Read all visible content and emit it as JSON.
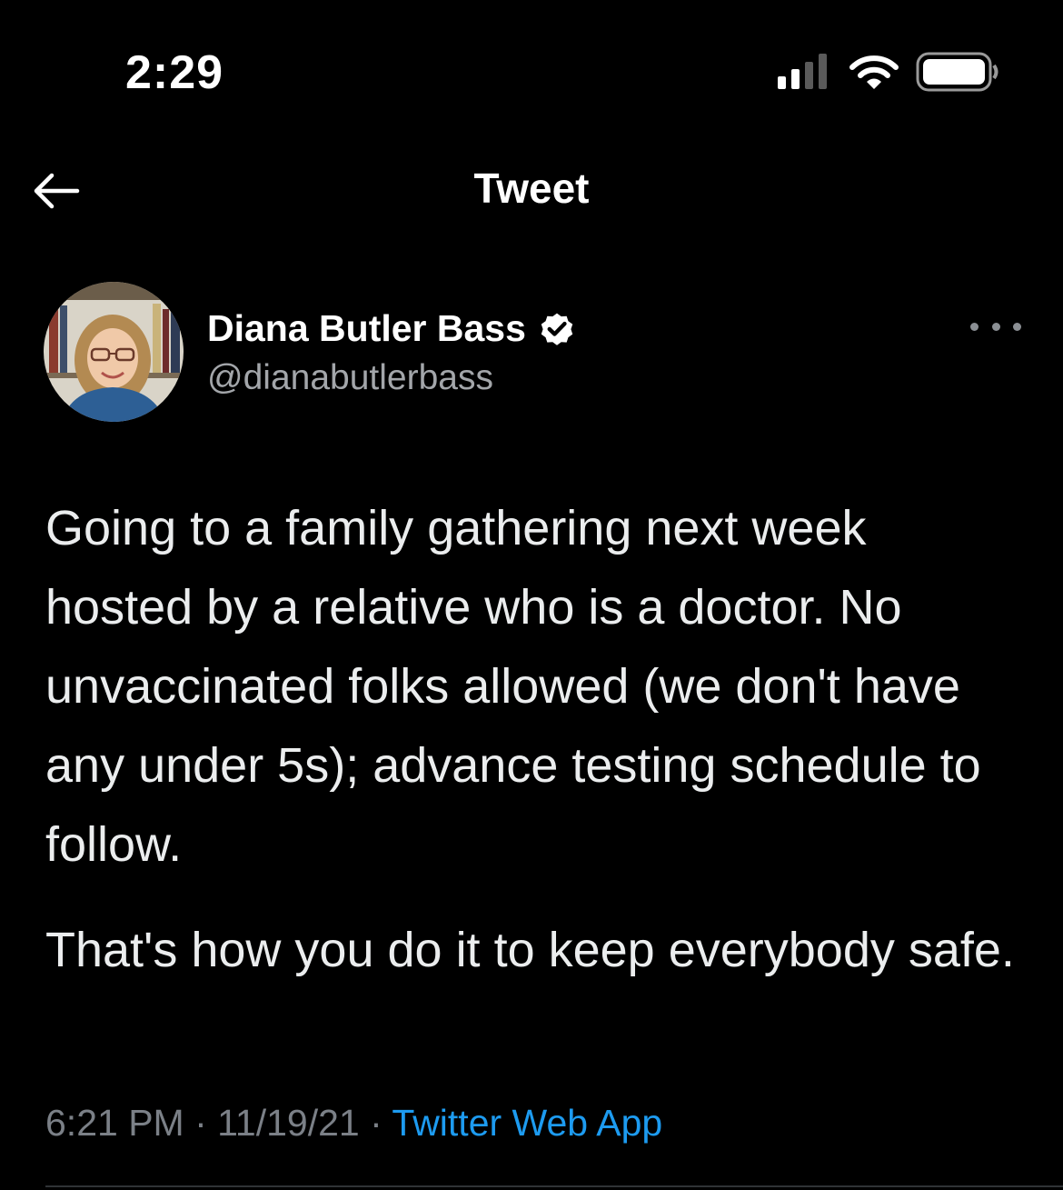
{
  "status_bar": {
    "time": "2:29",
    "signal_icon": "cellular-signal-icon",
    "wifi_icon": "wifi-icon",
    "battery_icon": "battery-icon"
  },
  "header": {
    "back_icon": "back-arrow-icon",
    "title": "Tweet"
  },
  "author": {
    "display_name": "Diana Butler Bass",
    "handle": "@dianabutlerbass",
    "verified_icon": "verified-badge-icon",
    "more_icon": "more-options-icon"
  },
  "tweet": {
    "paragraphs": [
      "Going to a family gathering next week hosted by a relative who is a doctor. No unvaccinated folks allowed (we don't have any under 5s); advance testing schedule to follow.",
      "That's how you do it to keep everybody safe."
    ],
    "time": "6:21 PM",
    "date": "11/19/21",
    "separator": " · ",
    "source": "Twitter Web App"
  },
  "colors": {
    "background": "#000000",
    "text": "#e7e9ea",
    "secondary_text": "#7b8087",
    "link": "#1d9bf0",
    "verified_badge": "#ffffff"
  }
}
